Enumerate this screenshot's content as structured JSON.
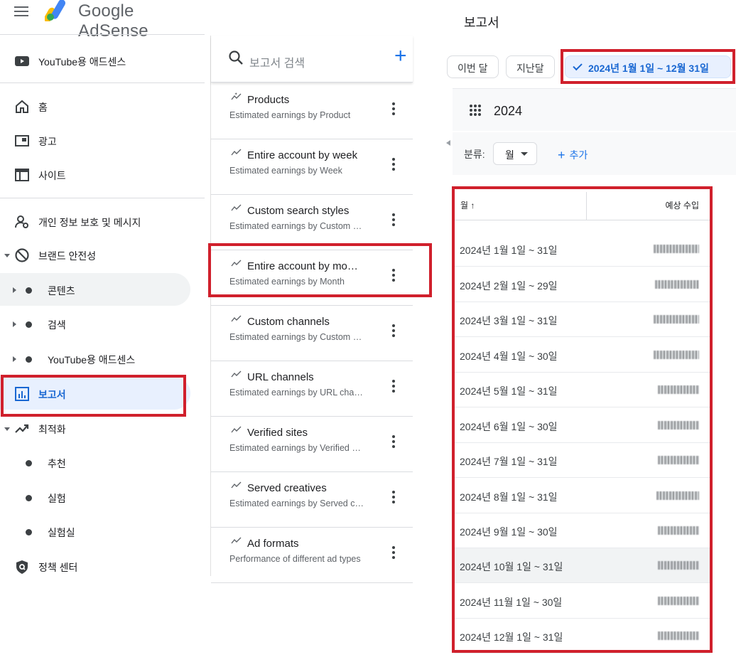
{
  "app": {
    "brand": "Google AdSense"
  },
  "sidebar": {
    "items": [
      {
        "label": "YouTube용 애드센스"
      },
      {
        "label": "홈"
      },
      {
        "label": "광고"
      },
      {
        "label": "사이트"
      },
      {
        "label": "개인 정보 보호 및 메시지"
      },
      {
        "label": "브랜드 안전성"
      },
      {
        "label": "콘텐츠"
      },
      {
        "label": "검색"
      },
      {
        "label": "YouTube용 애드센스"
      },
      {
        "label": "보고서"
      },
      {
        "label": "최적화"
      },
      {
        "label": "추천"
      },
      {
        "label": "실험"
      },
      {
        "label": "실험실"
      },
      {
        "label": "정책 센터"
      }
    ]
  },
  "reports": {
    "search_placeholder": "보고서 검색",
    "items": [
      {
        "title": "Products",
        "desc": "Estimated earnings by Product"
      },
      {
        "title": "Entire account by week",
        "desc": "Estimated earnings by Week"
      },
      {
        "title": "Custom search styles",
        "desc": "Estimated earnings by Custom search style"
      },
      {
        "title": "Entire account by month",
        "desc": "Estimated earnings by Month"
      },
      {
        "title": "Custom channels",
        "desc": "Estimated earnings by Custom channel"
      },
      {
        "title": "URL channels",
        "desc": "Estimated earnings by URL channel"
      },
      {
        "title": "Verified sites",
        "desc": "Estimated earnings by Verified site"
      },
      {
        "title": "Served creatives",
        "desc": "Estimated earnings by Served creative"
      },
      {
        "title": "Ad formats",
        "desc": "Performance of different ad types"
      }
    ]
  },
  "report_view": {
    "title": "보고서",
    "chips": [
      "이번 달",
      "지난달",
      "2024년 1월 1일 ~ 12월 31일"
    ],
    "year": "2024",
    "breakdown_label": "분류:",
    "breakdown_value": "월",
    "add_label": "추가",
    "table": {
      "col_month": "월 ↑",
      "col_earnings": "예상 수입",
      "rows": [
        "2024년 1월 1일 ~ 31일",
        "2024년 2월 1일 ~ 29일",
        "2024년 3월 1일 ~ 31일",
        "2024년 4월 1일 ~ 30일",
        "2024년 5월 1일 ~ 31일",
        "2024년 6월 1일 ~ 30일",
        "2024년 7월 1일 ~ 31일",
        "2024년 8월 1일 ~ 31일",
        "2024년 9월 1일 ~ 30일",
        "2024년 10월 1일 ~ 31일",
        "2024년 11월 1일 ~ 30일",
        "2024년 12월 1일 ~ 31일"
      ]
    }
  },
  "colors": {
    "accent": "#1a73e8",
    "active_bg": "#e8f0fe",
    "highlight_red": "#d0202c"
  }
}
